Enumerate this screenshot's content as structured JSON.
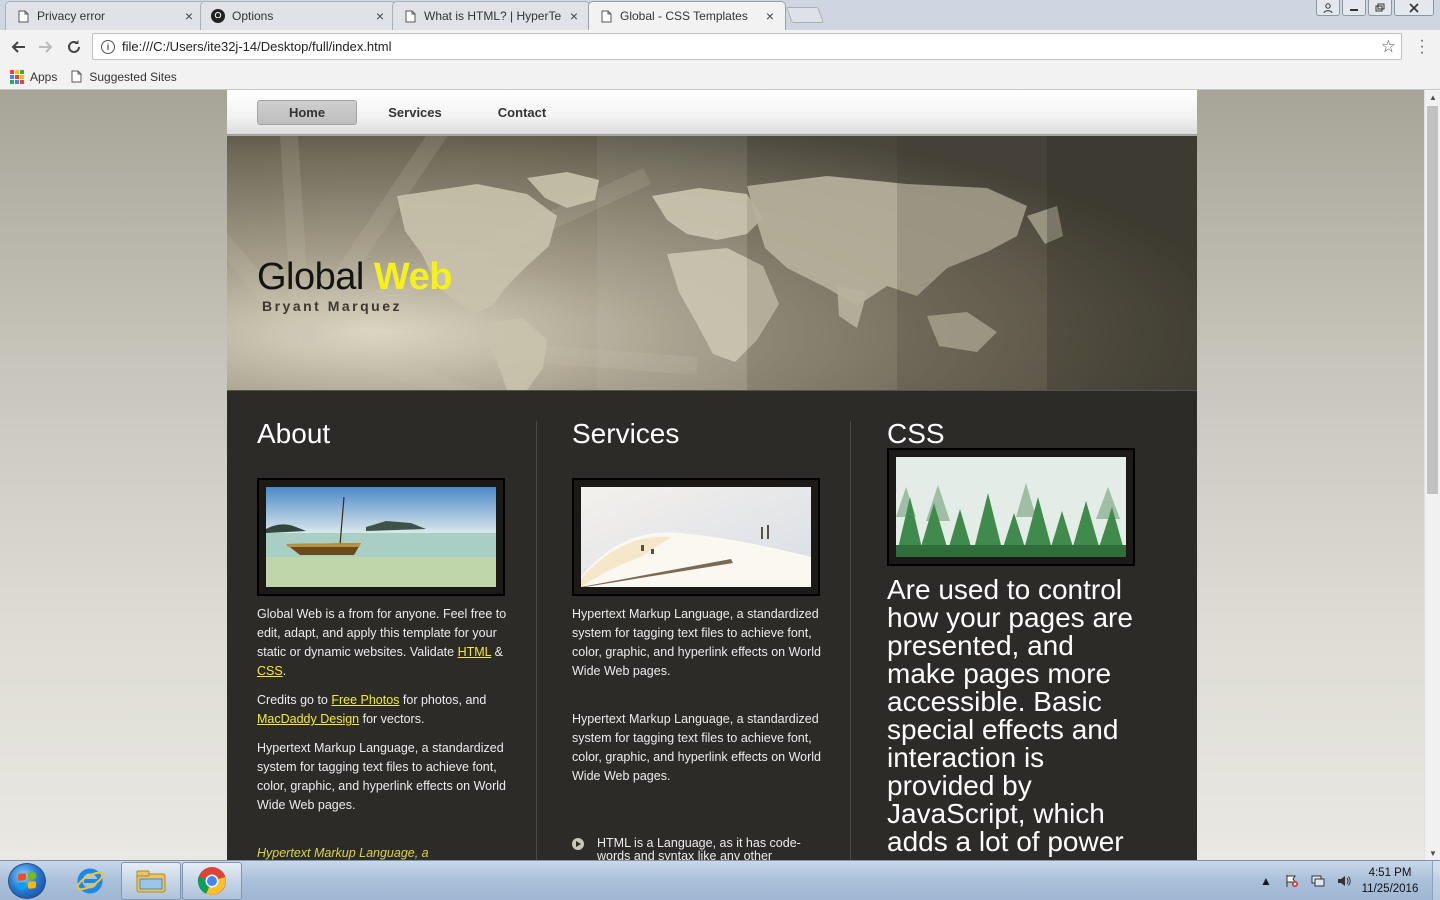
{
  "browser": {
    "tabs": [
      {
        "title": "Privacy error",
        "icon": "page-icon",
        "active": false
      },
      {
        "title": "Options",
        "icon": "github-icon",
        "active": false
      },
      {
        "title": "What is HTML? | HyperTe",
        "icon": "page-icon",
        "active": false
      },
      {
        "title": "Global - CSS Templates",
        "icon": "page-icon",
        "active": true
      }
    ],
    "tab_close_glyph": "×",
    "url": "file:///C:/Users/ite32j-14/Desktop/full/index.html",
    "bookmarks": [
      {
        "label": "Apps",
        "icon": "apps-grid-icon"
      },
      {
        "label": "Suggested Sites",
        "icon": "page-icon"
      }
    ],
    "apps_colors": [
      "#e94235",
      "#fbbc04",
      "#34a853",
      "#4285f4",
      "#e94235",
      "#fbbc04",
      "#34a853",
      "#4285f4",
      "#e94235"
    ]
  },
  "site": {
    "nav": [
      "Home",
      "Services",
      "Contact"
    ],
    "active_nav": "Home",
    "title_main": "Global",
    "title_accent": "Web",
    "subtitle": "Bryant Marquez",
    "colors": {
      "accent": "#f6f01e",
      "content_bg": "#2d2b27",
      "link": "#f3ea3c"
    }
  },
  "about": {
    "heading": "About",
    "p1_text": "Global Web is a from for anyone. Feel free to edit, adapt, and apply this template for your static or dynamic websites. Validate ",
    "p1_link1": "HTML",
    "p1_amp": " & ",
    "p1_link2": "CSS",
    "p1_end": ".",
    "p2_text": "Credits go to ",
    "p2_link1": "Free Photos",
    "p2_mid": " for photos, and ",
    "p2_link2": "MacDaddy Design",
    "p2_end": " for vectors.",
    "p3": "Hypertext Markup Language, a standardized system for tagging text files to achieve font, color, graphic, and hyperlink effects on World Wide Web pages.",
    "p4": "Hypertext Markup Language, a"
  },
  "services": {
    "heading": "Services",
    "p1": "Hypertext Markup Language, a standardized system for tagging text files to achieve font, color, graphic, and hyperlink effects on World Wide Web pages.",
    "p2": "Hypertext Markup Language, a standardized system for tagging text files to achieve font, color, graphic, and hyperlink effects on World Wide Web pages.",
    "bullet1": "HTML is a Language, as it has code-words and syntax like any other"
  },
  "css": {
    "heading": "CSS",
    "text": "Are used to control how your pages are presented, and make pages more accessible. Basic special effects and interaction is provided by JavaScript, which adds a lot of power"
  },
  "taskbar": {
    "time": "4:51 PM",
    "date": "11/25/2016",
    "pinned": [
      "internet-explorer-icon",
      "file-explorer-icon",
      "chrome-icon"
    ]
  }
}
